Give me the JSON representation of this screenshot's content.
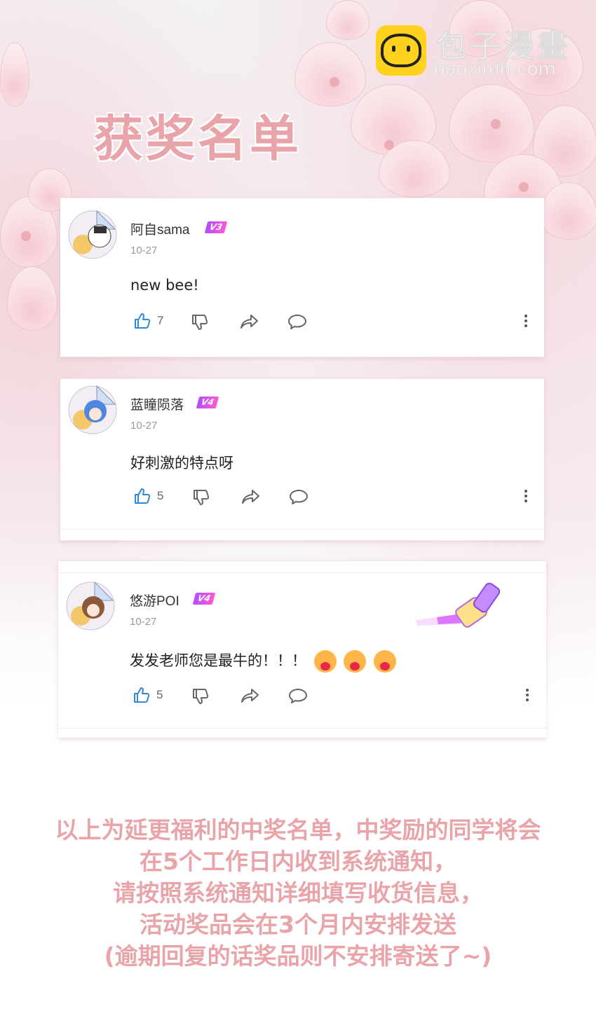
{
  "logo": {
    "text": "包子漫畫",
    "url": "baozimh.com"
  },
  "title": "获奖名单",
  "comments": [
    {
      "username": "阿自sama",
      "level": "V3",
      "date": "10-27",
      "text": "new bee!",
      "likes": "7"
    },
    {
      "username": "蓝瞳陨落",
      "level": "V4",
      "date": "10-27",
      "text": "好刺激的特点呀",
      "likes": "5"
    },
    {
      "username": "悠游POI",
      "level": "V4",
      "date": "10-27",
      "text": "发发老师您是最牛的！！！",
      "likes": "5"
    }
  ],
  "notice": {
    "lines": [
      "以上为延更福利的中奖名单，中奖励的同学将会",
      "在5个工作日内收到系统通知，",
      "请按照系统通知详细填写收货信息，",
      "活动奖品会在3个月内安排发送",
      "(逾期回复的话奖品则不安排寄送了~)"
    ]
  }
}
